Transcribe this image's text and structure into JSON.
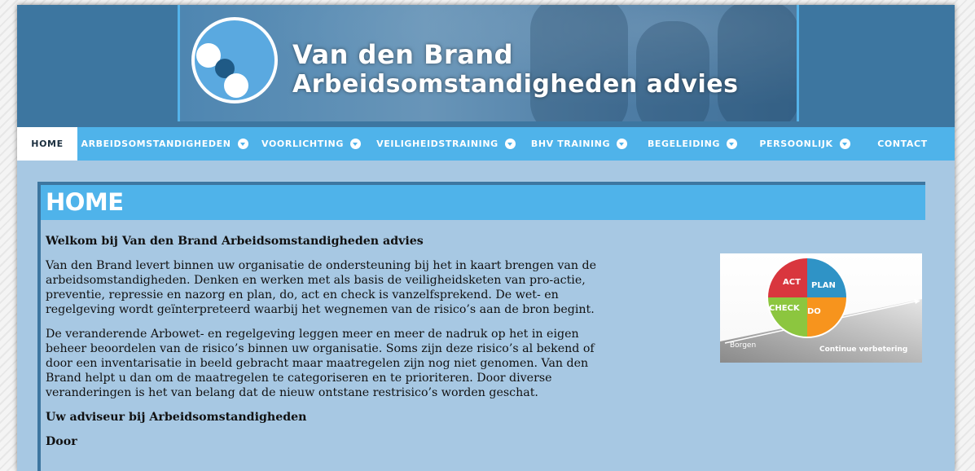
{
  "header": {
    "brand_line1": "Van den Brand",
    "brand_line2": "Arbeidsomstandigheden advies"
  },
  "nav": {
    "items": [
      {
        "label": "HOME",
        "dropdown": false,
        "active": true
      },
      {
        "label": "ARBEIDSOMSTANDIGHEDEN",
        "dropdown": true
      },
      {
        "label": "VOORLICHTING",
        "dropdown": true
      },
      {
        "label": "VEILIGHEIDSTRAINING",
        "dropdown": true
      },
      {
        "label": "BHV TRAINING",
        "dropdown": true
      },
      {
        "label": "BEGELEIDING",
        "dropdown": true
      },
      {
        "label": "PERSOONLIJK",
        "dropdown": true
      },
      {
        "label": "CONTACT",
        "dropdown": false
      }
    ]
  },
  "page": {
    "title": "HOME",
    "welcome": "Welkom bij Van den Brand Arbeidsomstandigheden advies",
    "para1": "Van den Brand levert binnen uw organisatie de ondersteuning bij het in kaart brengen van de arbeidsomstandigheden. Denken en werken met als basis de veiligheidsketen van pro-actie, preventie, repressie en nazorg en plan, do, act en check is vanzelfsprekend. De wet- en regelgeving wordt geïnterpreteerd waarbij het wegnemen van de risico’s aan de bron begint.",
    "para2": "De veranderende Arbowet- en regelgeving leggen meer en meer de nadruk op het in eigen beheer beoordelen van de risico’s binnen uw organisatie. Soms zijn deze risico’s al bekend of door een inventarisatie in beeld gebracht maar maatregelen zijn nog niet genomen. Van den Brand helpt u dan om de maatregelen te categoriseren en te prioriteren. Door diverse veranderingen is het van belang dat de nieuw ontstane restrisico’s worden geschat.",
    "subheading": "Uw adviseur bij Arbeidsomstandigheden",
    "subheading2": "Door"
  },
  "pdca": {
    "act": "ACT",
    "plan": "PLAN",
    "check": "CHECK",
    "do": "DO",
    "borgen": "Borgen",
    "continue": "Continue verbetering"
  },
  "colors": {
    "nav_bg": "#4fb3ea",
    "header_bg": "#3d76a0",
    "content_bg": "#a7c8e3",
    "act": "#d9363e",
    "plan": "#2f93c6",
    "check": "#8cc63f",
    "do": "#f7941d"
  }
}
